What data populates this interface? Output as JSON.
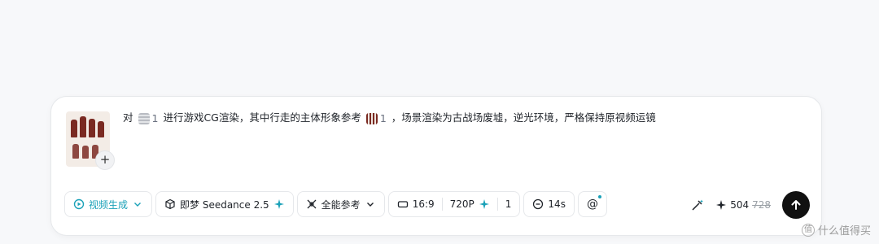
{
  "prompt": {
    "part1": "对",
    "ref1_index": "1",
    "part2": "进行游戏CG渲染，其中行走的主体形象参考",
    "ref2_index": "1",
    "part3": "，场景渲染为古战场废墟，逆光环境，严格保持原视频运镜"
  },
  "thumbnail": {
    "add_label": "+"
  },
  "toolbar": {
    "mode_label": "视频生成",
    "model_label": "即梦 Seedance 2.5",
    "reference_label": "全能参考",
    "ratio_label": "16:9",
    "resolution_label": "720P",
    "count_label": "1",
    "duration_label": "14s",
    "mention_label": "@"
  },
  "credits": {
    "current": "504",
    "original": "728"
  },
  "watermark": {
    "badge": "值",
    "text": "什么值得买"
  },
  "colors": {
    "accent": "#1aa1b8",
    "send": "#111111"
  }
}
